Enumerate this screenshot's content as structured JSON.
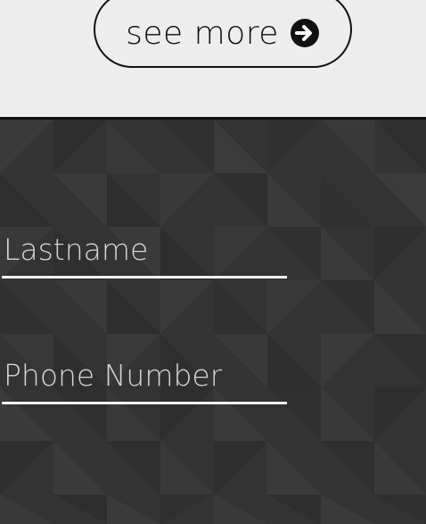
{
  "top_section": {
    "see_more_label": "see more",
    "see_more_icon": "arrow-circle-right-icon"
  },
  "form": {
    "lastname_placeholder": "Lastname",
    "phone_placeholder": "Phone Number"
  },
  "colors": {
    "top_background": "#ededed",
    "form_background": "#333333",
    "text_on_dark": "#d6d6d6",
    "underline": "#f2f2f2"
  }
}
